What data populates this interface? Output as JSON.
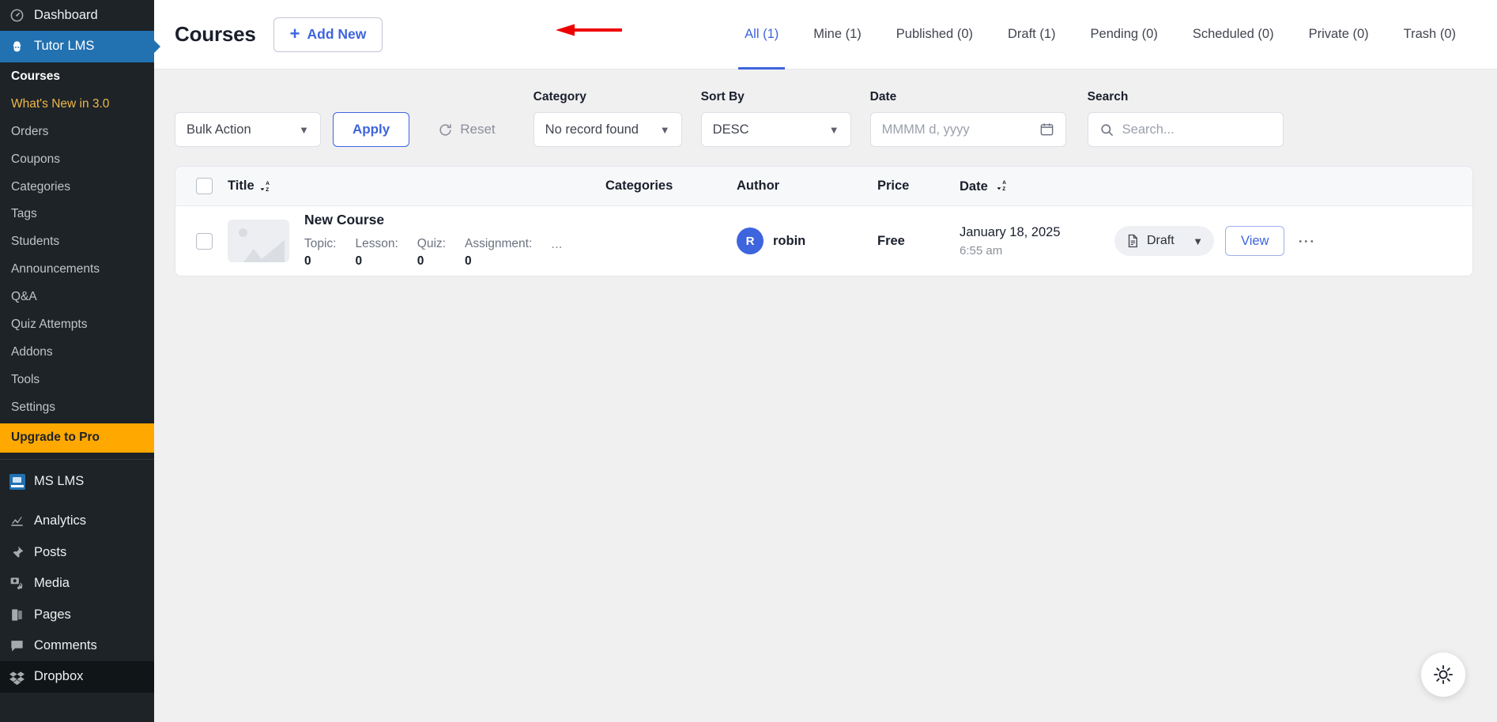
{
  "sidebar": {
    "top_items": [
      {
        "label": "Dashboard",
        "icon": "dashboard-icon",
        "active": false
      },
      {
        "label": "Tutor LMS",
        "icon": "tutor-lms-icon",
        "active": true
      }
    ],
    "tutor_submenu": [
      {
        "label": "Courses",
        "state": "current"
      },
      {
        "label": "What's New in 3.0",
        "state": "highlight"
      },
      {
        "label": "Orders",
        "state": "normal"
      },
      {
        "label": "Coupons",
        "state": "normal"
      },
      {
        "label": "Categories",
        "state": "normal"
      },
      {
        "label": "Tags",
        "state": "normal"
      },
      {
        "label": "Students",
        "state": "normal"
      },
      {
        "label": "Announcements",
        "state": "normal"
      },
      {
        "label": "Q&A",
        "state": "normal"
      },
      {
        "label": "Quiz Attempts",
        "state": "normal"
      },
      {
        "label": "Addons",
        "state": "normal"
      },
      {
        "label": "Tools",
        "state": "normal"
      },
      {
        "label": "Settings",
        "state": "normal"
      },
      {
        "label": "Upgrade to Pro",
        "state": "upgrade"
      }
    ],
    "bottom_items": [
      {
        "label": "MS LMS",
        "icon": "ms-lms-icon"
      },
      {
        "label": "Analytics",
        "icon": "analytics-icon"
      },
      {
        "label": "Posts",
        "icon": "pin-icon"
      },
      {
        "label": "Media",
        "icon": "media-icon"
      },
      {
        "label": "Pages",
        "icon": "pages-icon"
      },
      {
        "label": "Comments",
        "icon": "comments-icon"
      },
      {
        "label": "Dropbox",
        "icon": "dropbox-icon"
      }
    ]
  },
  "header": {
    "title": "Courses",
    "add_new_label": "Add New",
    "plus": "+",
    "tabs": [
      {
        "label": "All (1)",
        "active": true
      },
      {
        "label": "Mine (1)",
        "active": false
      },
      {
        "label": "Published (0)",
        "active": false
      },
      {
        "label": "Draft (1)",
        "active": false
      },
      {
        "label": "Pending (0)",
        "active": false
      },
      {
        "label": "Scheduled (0)",
        "active": false
      },
      {
        "label": "Private (0)",
        "active": false
      },
      {
        "label": "Trash (0)",
        "active": false
      }
    ]
  },
  "filters": {
    "bulk_action_value": "Bulk Action",
    "apply_label": "Apply",
    "reset_label": "Reset",
    "category_label": "Category",
    "category_value": "No record found",
    "sort_by_label": "Sort By",
    "sort_by_value": "DESC",
    "date_label": "Date",
    "date_placeholder": "MMMM d, yyyy",
    "search_label": "Search",
    "search_placeholder": "Search...",
    "search_value": ""
  },
  "table": {
    "headers": {
      "title": "Title",
      "categories": "Categories",
      "author": "Author",
      "price": "Price",
      "date": "Date"
    },
    "rows": [
      {
        "name": "New Course",
        "meta": [
          {
            "label": "Topic:",
            "value": "0"
          },
          {
            "label": "Lesson:",
            "value": "0"
          },
          {
            "label": "Quiz:",
            "value": "0"
          },
          {
            "label": "Assignment:",
            "value": "0"
          }
        ],
        "meta_overflow": "...",
        "categories": "",
        "author_initial": "R",
        "author": "robin",
        "price": "Free",
        "date": "January 18, 2025",
        "time": "6:55 am",
        "status": "Draft",
        "view_label": "View"
      }
    ]
  },
  "colors": {
    "accent": "#3e64de",
    "sidebar_active": "#2271b1",
    "upgrade": "#ffa800",
    "whats_new": "#f0b849",
    "annotation_arrow": "#ee0000"
  },
  "theme_toggle": {
    "icon": "sun-icon"
  }
}
